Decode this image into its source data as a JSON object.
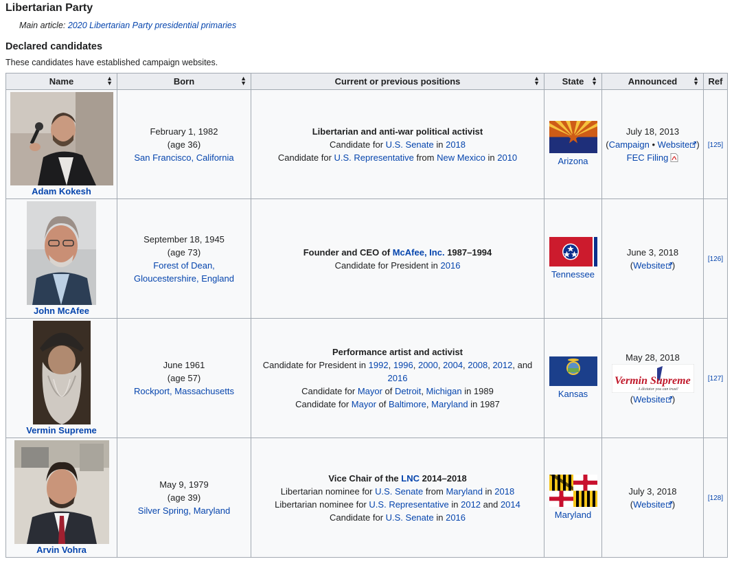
{
  "section": {
    "title": "Libertarian Party",
    "main_article_prefix": "Main article: ",
    "main_article_link": "2020 Libertarian Party presidential primaries",
    "subheading": "Declared candidates",
    "intro": "These candidates have established campaign websites."
  },
  "table": {
    "headers": [
      "Name",
      "Born",
      "Current or previous positions",
      "State",
      "Announced",
      "Ref"
    ],
    "rows": [
      {
        "name": "Adam Kokesh",
        "born_date": "February 1, 1982",
        "born_age": "(age 36)",
        "born_place": "San Francisco, California",
        "positions_title": "Libertarian and anti-war political activist",
        "p1_pre": "Candidate for ",
        "p1_l1": "U.S. Senate",
        "p1_mid": " in ",
        "p1_l2": "2018",
        "p2_pre": "Candidate for ",
        "p2_l1": "U.S. Representative",
        "p2_mid": " from ",
        "p2_l2": "New Mexico",
        "p2_mid2": " in ",
        "p2_l3": "2010",
        "state": "Arizona",
        "announced": "July 18, 2013",
        "link_campaign": "Campaign",
        "link_sep": " • ",
        "link_website": "Website",
        "link_fec": "FEC Filing",
        "ref": "[125]"
      },
      {
        "name": "John McAfee",
        "born_date": "September 18, 1945",
        "born_age": "(age 73)",
        "born_place": "Forest of Dean, Gloucestershire, England",
        "positions_title_pre": "Founder and CEO of ",
        "positions_title_link": "McAfee, Inc.",
        "positions_title_post": " 1987–1994",
        "p1_pre": "Candidate for President in ",
        "p1_l1": "2016",
        "state": "Tennessee",
        "announced": "June 3, 2018",
        "link_website": "Website",
        "ref": "[126]"
      },
      {
        "name": "Vermin Supreme",
        "born_date": "June 1961",
        "born_age": "(age 57)",
        "born_place": "Rockport, Massachusetts",
        "positions_title": "Performance artist and activist",
        "p1_pre": "Candidate for President in ",
        "years": [
          "1992",
          "1996",
          "2000",
          "2004",
          "2008",
          "2012",
          "2016"
        ],
        "years_and": ", and ",
        "p2_pre": "Candidate for ",
        "p2_l1": "Mayor",
        "p2_mid": " of ",
        "p2_l2": "Detroit",
        "p2_l3": "Michigan",
        "p2_post": " in 1989",
        "p3_pre": "Candidate for ",
        "p3_l1": "Mayor",
        "p3_mid": " of ",
        "p3_l2": "Baltimore",
        "p3_l3": "Maryland",
        "p3_post": " in 1987",
        "state": "Kansas",
        "announced": "May 28, 2018",
        "logo_name": "Vermin Supreme",
        "logo_tagline": "A dictator you can trust!",
        "link_website": "Website",
        "ref": "[127]"
      },
      {
        "name": "Arvin Vohra",
        "born_date": "May 9, 1979",
        "born_age": "(age 39)",
        "born_place": "Silver Spring, Maryland",
        "positions_title_pre": "Vice Chair of the ",
        "positions_title_link": "LNC",
        "positions_title_post": " 2014–2018",
        "p1_pre": "Libertarian nominee for ",
        "p1_l1": "U.S. Senate",
        "p1_mid": " from ",
        "p1_l2": "Maryland",
        "p1_mid2": " in ",
        "p1_l3": "2018",
        "p2_pre": "Libertarian nominee for ",
        "p2_l1": "U.S. Representative",
        "p2_mid": " in ",
        "p2_l2": "2012",
        "p2_mid2": " and ",
        "p2_l3": "2014",
        "p3_pre": "Candidate for ",
        "p3_l1": "U.S. Senate",
        "p3_mid": " in ",
        "p3_l2": "2016",
        "state": "Maryland",
        "announced": "July 3, 2018",
        "link_website": "Website",
        "ref": "[128]"
      }
    ]
  },
  "colors": {
    "link": "#0645ad",
    "header_bg": "#eaecf0",
    "cell_bg": "#f8f9fa",
    "border": "#a2a9b1"
  }
}
